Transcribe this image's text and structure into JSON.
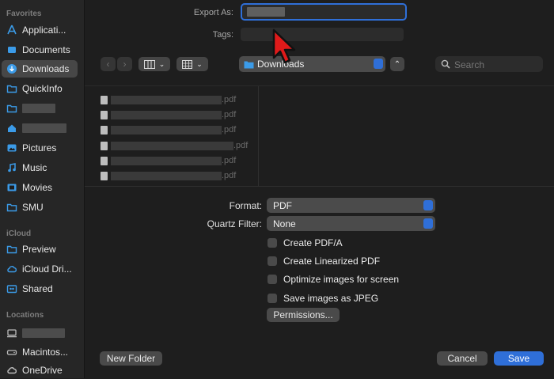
{
  "sidebar": {
    "favorites_header": "Favorites",
    "icloud_header": "iCloud",
    "locations_header": "Locations",
    "favorites": [
      {
        "label": "Applicati...",
        "icon": "apps-icon"
      },
      {
        "label": "Documents",
        "icon": "document-icon"
      },
      {
        "label": "Downloads",
        "icon": "download-icon"
      },
      {
        "label": "QuickInfo",
        "icon": "folder-icon"
      },
      {
        "label": "",
        "icon": "folder-icon"
      },
      {
        "label": "",
        "icon": "home-icon"
      },
      {
        "label": "Pictures",
        "icon": "pictures-icon"
      },
      {
        "label": "Music",
        "icon": "music-icon"
      },
      {
        "label": "Movies",
        "icon": "movies-icon"
      },
      {
        "label": "SMU",
        "icon": "folder-icon"
      }
    ],
    "icloud": [
      {
        "label": "Preview",
        "icon": "folder-icon"
      },
      {
        "label": "iCloud Dri...",
        "icon": "cloud-icon"
      },
      {
        "label": "Shared",
        "icon": "shared-icon"
      }
    ],
    "locations": [
      {
        "label": "",
        "icon": "computer-icon"
      },
      {
        "label": "Macintos...",
        "icon": "disk-icon"
      },
      {
        "label": "OneDrive",
        "icon": "cloud-icon"
      }
    ]
  },
  "form": {
    "export_as_label": "Export As:",
    "export_as_value": "",
    "tags_label": "Tags:",
    "tags_value": ""
  },
  "toolbar": {
    "location": "Downloads",
    "search_placeholder": "Search"
  },
  "files": [
    {
      "ext": ".pdf"
    },
    {
      "ext": ".pdf"
    },
    {
      "ext": ".pdf"
    },
    {
      "ext": ".pdf"
    },
    {
      "ext": ".pdf"
    },
    {
      "ext": ".pdf"
    }
  ],
  "options": {
    "format_label": "Format:",
    "format_value": "PDF",
    "quartz_label": "Quartz Filter:",
    "quartz_value": "None",
    "checkboxes": [
      {
        "label": "Create PDF/A",
        "checked": false
      },
      {
        "label": "Create Linearized PDF",
        "checked": false
      },
      {
        "label": "Optimize images for screen",
        "checked": false
      },
      {
        "label": "Save images as JPEG",
        "checked": false
      }
    ],
    "permissions_label": "Permissions..."
  },
  "footer": {
    "new_folder": "New Folder",
    "cancel": "Cancel",
    "save": "Save"
  },
  "colors": {
    "accent": "#2f6fd8",
    "folder_blue": "#3b9be8"
  }
}
